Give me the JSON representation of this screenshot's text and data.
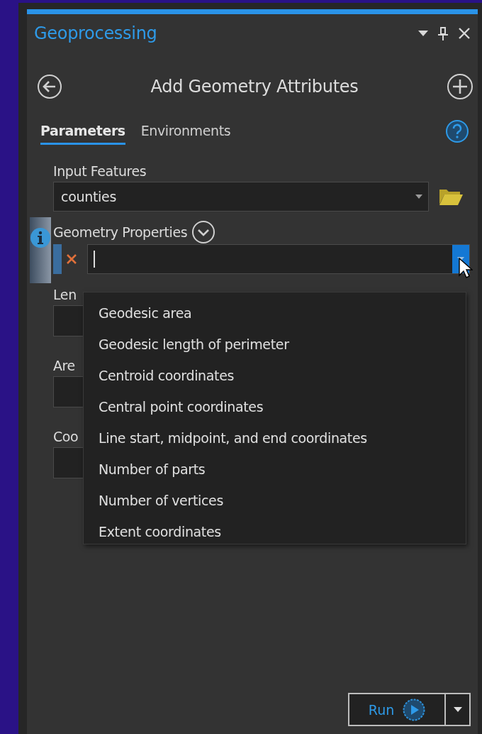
{
  "pane": {
    "title": "Geoprocessing"
  },
  "tool": {
    "title": "Add Geometry Attributes"
  },
  "tabs": [
    {
      "label": "Parameters",
      "selected": true
    },
    {
      "label": "Environments",
      "selected": false
    }
  ],
  "input_features": {
    "label": "Input Features",
    "value": "counties"
  },
  "geometry_properties": {
    "label": "Geometry Properties",
    "expanded": true
  },
  "dropdown_options": [
    {
      "label": "Geodesic area"
    },
    {
      "label": "Geodesic length of perimeter"
    },
    {
      "label": "Centroid coordinates"
    },
    {
      "label": "Central point coordinates"
    },
    {
      "label": "Line start, midpoint, and end coordinates"
    },
    {
      "label": "Number of parts"
    },
    {
      "label": "Number of vertices"
    },
    {
      "label": "Extent coordinates"
    }
  ],
  "hidden_parameters": [
    {
      "label": "Len"
    },
    {
      "label": "Are"
    },
    {
      "label": "Coo"
    }
  ],
  "run_button": {
    "label": "Run"
  }
}
